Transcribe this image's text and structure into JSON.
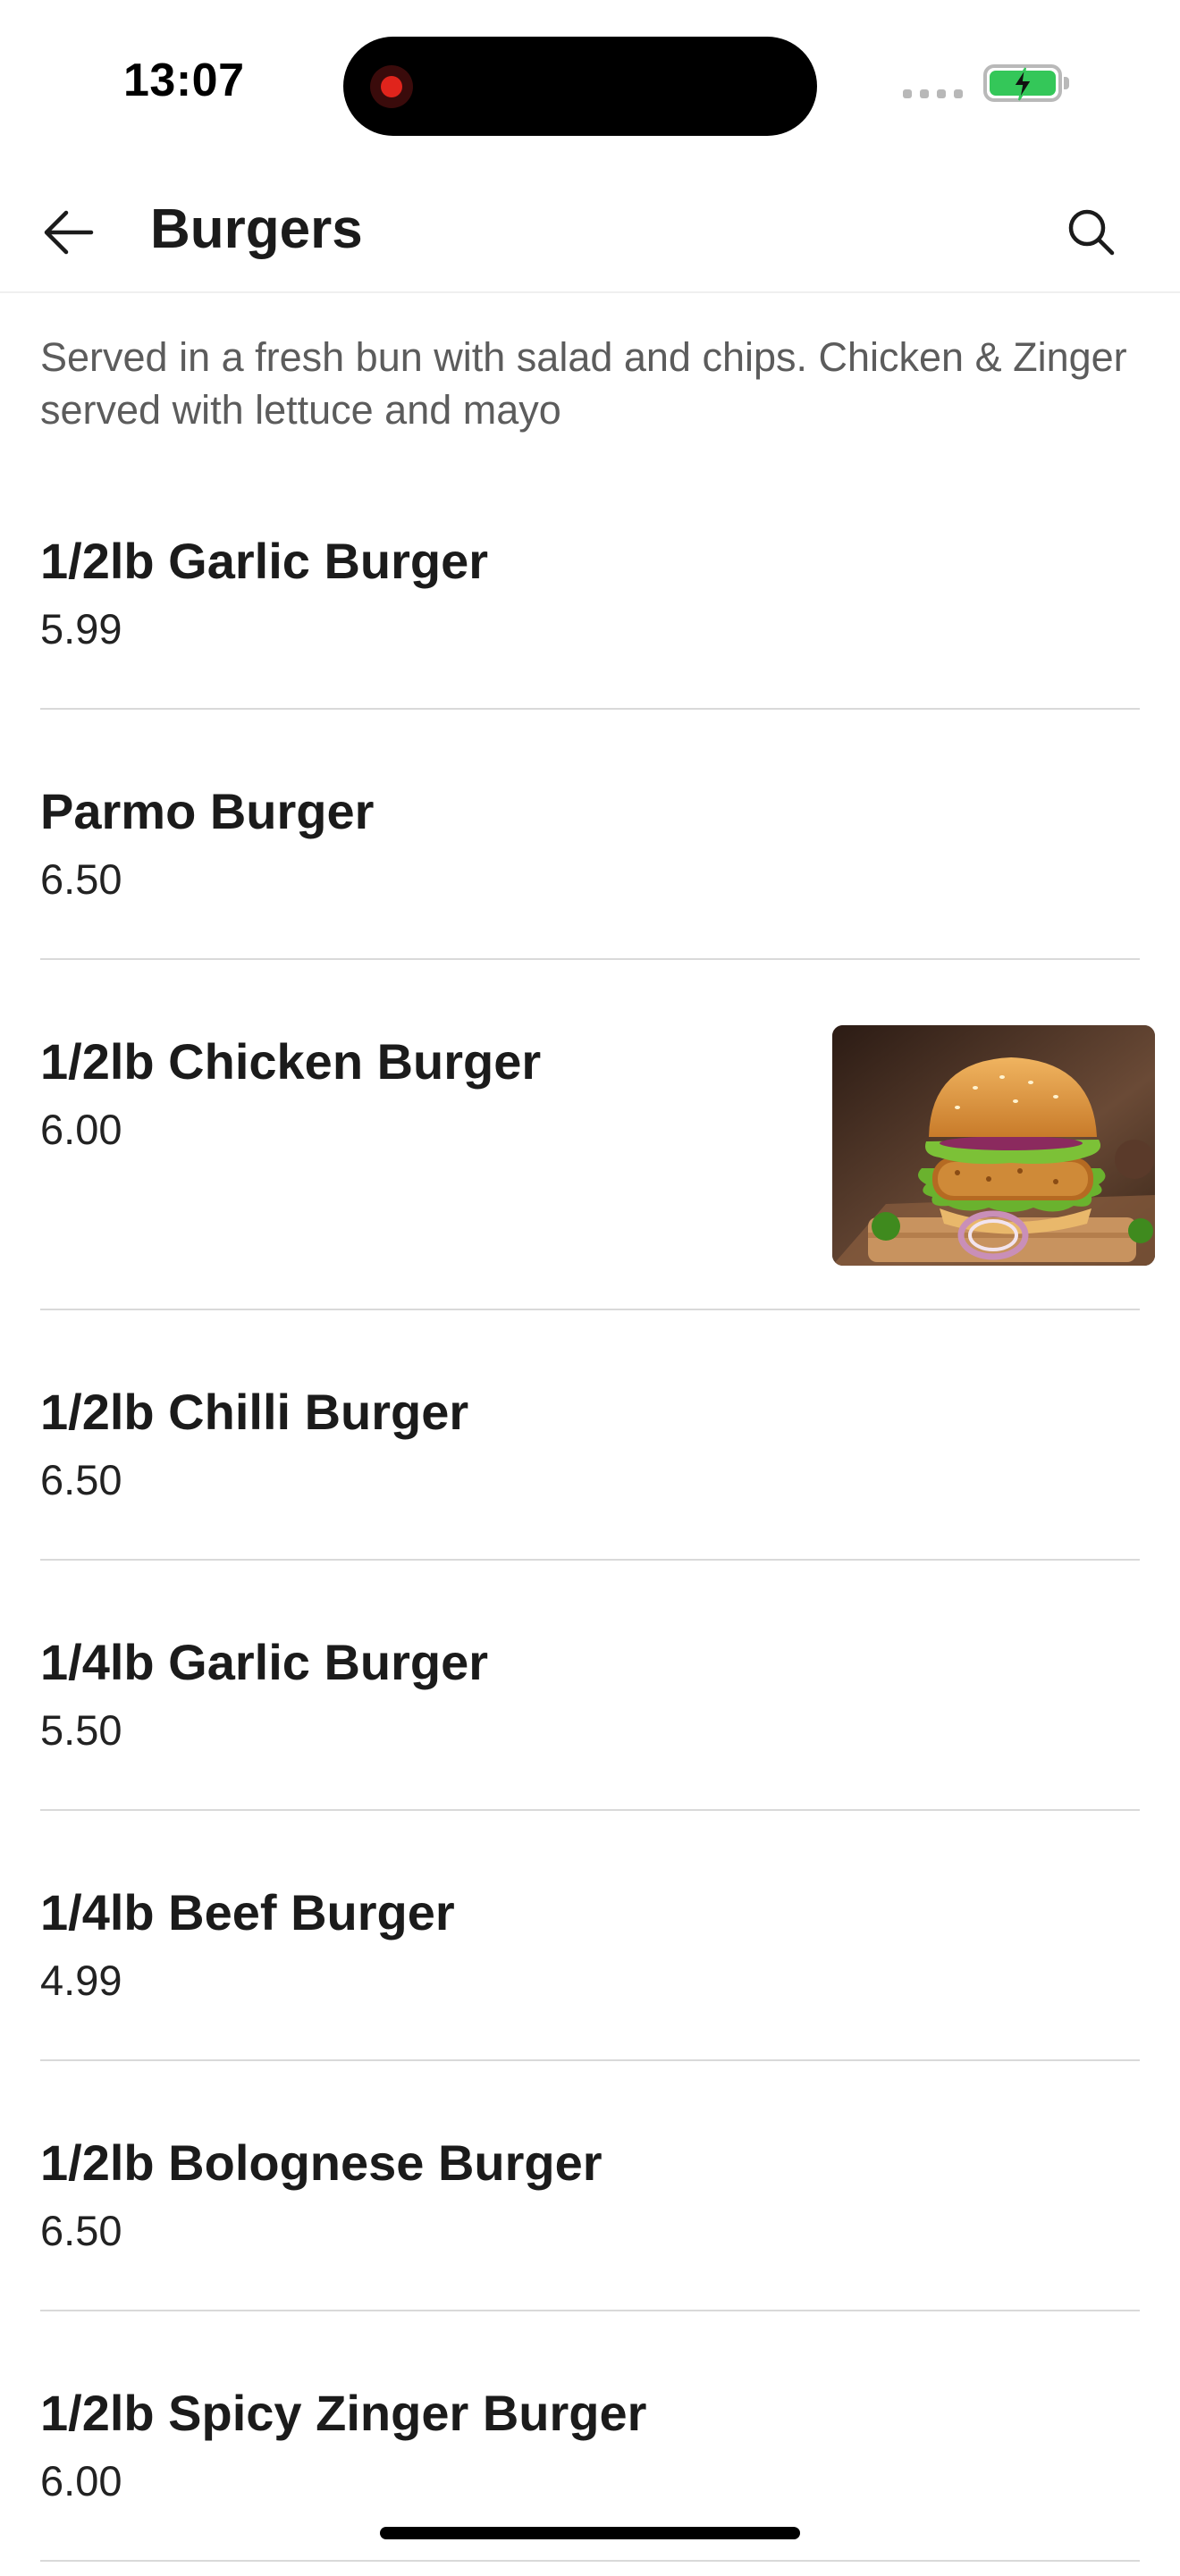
{
  "status_bar": {
    "time": "13:07"
  },
  "header": {
    "title": "Burgers",
    "back_icon": "arrow-left-icon",
    "search_icon": "search-icon"
  },
  "category": {
    "description": "Served in a fresh bun with salad and chips. Chicken & Zinger served with lettuce and mayo"
  },
  "items": [
    {
      "name": "1/2lb Garlic Burger",
      "price": "5.99"
    },
    {
      "name": "Parmo Burger",
      "price": "6.50"
    },
    {
      "name": "1/2lb Chicken Burger",
      "price": "6.00",
      "image": "burger-photo"
    },
    {
      "name": "1/2lb Chilli Burger",
      "price": "6.50"
    },
    {
      "name": "1/4lb Garlic Burger",
      "price": "5.50"
    },
    {
      "name": "1/4lb Beef Burger",
      "price": "4.99"
    },
    {
      "name": "1/2lb Bolognese Burger",
      "price": "6.50"
    },
    {
      "name": "1/2lb Spicy Zinger Burger",
      "price": "6.00"
    }
  ],
  "colors": {
    "battery_fill": "#34c759",
    "recording_dot": "#e0241c",
    "divider": "#d9d9d9"
  }
}
